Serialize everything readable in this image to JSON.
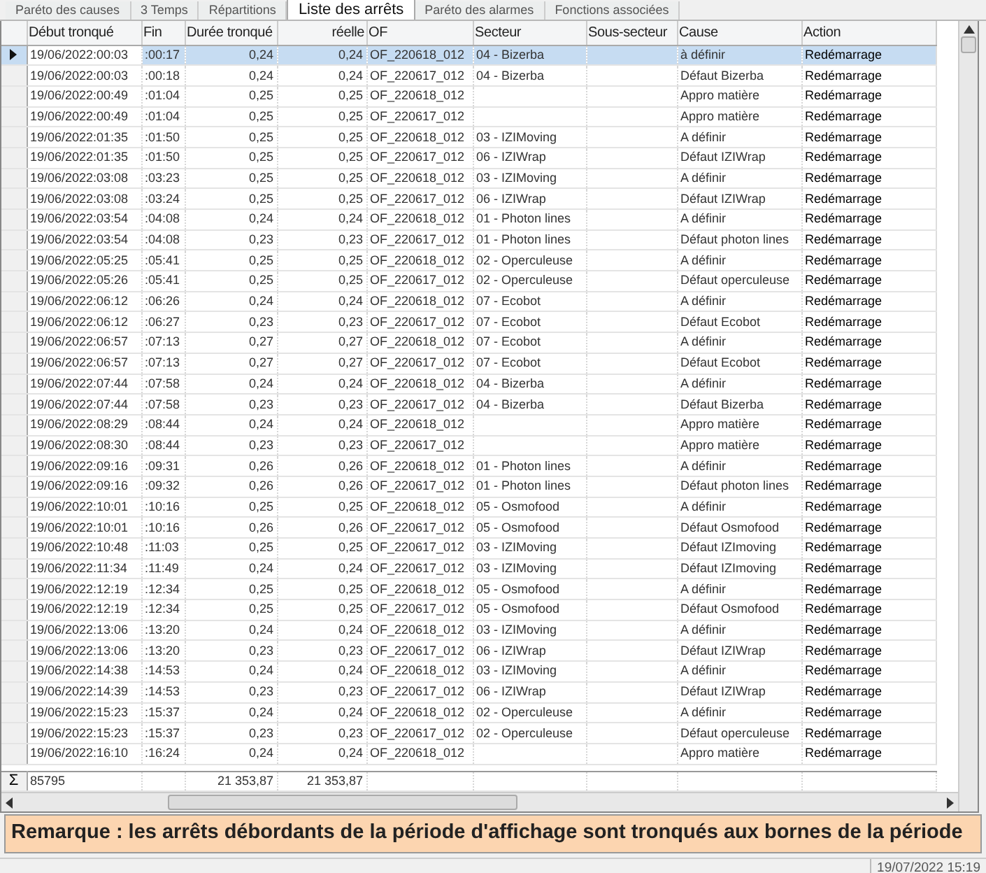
{
  "tabs": [
    {
      "label": "Paréto des causes",
      "selected": false
    },
    {
      "label": "3 Temps",
      "selected": false
    },
    {
      "label": "Répartitions",
      "selected": false
    },
    {
      "label": "Liste des arrêts",
      "selected": true
    },
    {
      "label": "Paréto des alarmes",
      "selected": false
    },
    {
      "label": "Fonctions associées",
      "selected": false
    }
  ],
  "table": {
    "columns": [
      "Début tronqué",
      "Fin",
      "Durée tronqué",
      "réelle",
      "OF",
      "Secteur",
      "Sous-secteur",
      "Cause",
      "Action"
    ],
    "rows": [
      {
        "debut": "19/06/2022:00:03",
        "fin": ":00:17",
        "duree": "0,24",
        "reelle": "0,24",
        "of": "OF_220618_012",
        "secteur": "04 - Bizerba",
        "cause": "à définir",
        "action": "Redémarrage",
        "selected": true
      },
      {
        "debut": "19/06/2022:00:03",
        "fin": ":00:18",
        "duree": "0,24",
        "reelle": "0,24",
        "of": "OF_220617_012",
        "secteur": "04 - Bizerba",
        "cause": "Défaut Bizerba",
        "action": "Redémarrage",
        "selected": false
      },
      {
        "debut": "19/06/2022:00:49",
        "fin": ":01:04",
        "duree": "0,25",
        "reelle": "0,25",
        "of": "OF_220618_012",
        "cause": "Appro matière",
        "action": "Redémarrage",
        "selected": false
      },
      {
        "debut": "19/06/2022:00:49",
        "fin": ":01:04",
        "duree": "0,25",
        "reelle": "0,25",
        "of": "OF_220617_012",
        "cause": "Appro matière",
        "action": "Redémarrage",
        "selected": false
      },
      {
        "debut": "19/06/2022:01:35",
        "fin": ":01:50",
        "duree": "0,25",
        "reelle": "0,25",
        "of": "OF_220618_012",
        "secteur": "03 - IZIMoving",
        "cause": "A définir",
        "action": "Redémarrage",
        "selected": false
      },
      {
        "debut": "19/06/2022:01:35",
        "fin": ":01:50",
        "duree": "0,25",
        "reelle": "0,25",
        "of": "OF_220617_012",
        "secteur": "06 - IZIWrap",
        "cause": "Défaut IZIWrap",
        "action": "Redémarrage",
        "selected": false
      },
      {
        "debut": "19/06/2022:03:08",
        "fin": ":03:23",
        "duree": "0,25",
        "reelle": "0,25",
        "of": "OF_220618_012",
        "secteur": "03 - IZIMoving",
        "cause": "A définir",
        "action": "Redémarrage",
        "selected": false
      },
      {
        "debut": "19/06/2022:03:08",
        "fin": ":03:24",
        "duree": "0,25",
        "reelle": "0,25",
        "of": "OF_220617_012",
        "secteur": "06 - IZIWrap",
        "cause": "Défaut IZIWrap",
        "action": "Redémarrage",
        "selected": false
      },
      {
        "debut": "19/06/2022:03:54",
        "fin": ":04:08",
        "duree": "0,24",
        "reelle": "0,24",
        "of": "OF_220618_012",
        "secteur": "01 - Photon lines",
        "cause": "A définir",
        "action": "Redémarrage",
        "selected": false
      },
      {
        "debut": "19/06/2022:03:54",
        "fin": ":04:08",
        "duree": "0,23",
        "reelle": "0,23",
        "of": "OF_220617_012",
        "secteur": "01 - Photon lines",
        "cause": "Défaut photon lines",
        "action": "Redémarrage",
        "selected": false
      },
      {
        "debut": "19/06/2022:05:25",
        "fin": ":05:41",
        "duree": "0,25",
        "reelle": "0,25",
        "of": "OF_220618_012",
        "secteur": "02 - Operculeuse",
        "cause": "A définir",
        "action": "Redémarrage",
        "selected": false
      },
      {
        "debut": "19/06/2022:05:26",
        "fin": ":05:41",
        "duree": "0,25",
        "reelle": "0,25",
        "of": "OF_220617_012",
        "secteur": "02 - Operculeuse",
        "cause": "Défaut operculeuse",
        "action": "Redémarrage",
        "selected": false
      },
      {
        "debut": "19/06/2022:06:12",
        "fin": ":06:26",
        "duree": "0,24",
        "reelle": "0,24",
        "of": "OF_220618_012",
        "secteur": "07 - Ecobot",
        "cause": "A définir",
        "action": "Redémarrage",
        "selected": false
      },
      {
        "debut": "19/06/2022:06:12",
        "fin": ":06:27",
        "duree": "0,23",
        "reelle": "0,23",
        "of": "OF_220617_012",
        "secteur": "07 - Ecobot",
        "cause": "Défaut Ecobot",
        "action": "Redémarrage",
        "selected": false
      },
      {
        "debut": "19/06/2022:06:57",
        "fin": ":07:13",
        "duree": "0,27",
        "reelle": "0,27",
        "of": "OF_220618_012",
        "secteur": "07 - Ecobot",
        "cause": "A définir",
        "action": "Redémarrage",
        "selected": false
      },
      {
        "debut": "19/06/2022:06:57",
        "fin": ":07:13",
        "duree": "0,27",
        "reelle": "0,27",
        "of": "OF_220617_012",
        "secteur": "07 - Ecobot",
        "cause": "Défaut Ecobot",
        "action": "Redémarrage",
        "selected": false
      },
      {
        "debut": "19/06/2022:07:44",
        "fin": ":07:58",
        "duree": "0,24",
        "reelle": "0,24",
        "of": "OF_220618_012",
        "secteur": "04 - Bizerba",
        "cause": "A définir",
        "action": "Redémarrage",
        "selected": false
      },
      {
        "debut": "19/06/2022:07:44",
        "fin": ":07:58",
        "duree": "0,23",
        "reelle": "0,23",
        "of": "OF_220617_012",
        "secteur": "04 - Bizerba",
        "cause": "Défaut Bizerba",
        "action": "Redémarrage",
        "selected": false
      },
      {
        "debut": "19/06/2022:08:29",
        "fin": ":08:44",
        "duree": "0,24",
        "reelle": "0,24",
        "of": "OF_220618_012",
        "cause": "Appro matière",
        "action": "Redémarrage",
        "selected": false
      },
      {
        "debut": "19/06/2022:08:30",
        "fin": ":08:44",
        "duree": "0,23",
        "reelle": "0,23",
        "of": "OF_220617_012",
        "cause": "Appro matière",
        "action": "Redémarrage",
        "selected": false
      },
      {
        "debut": "19/06/2022:09:16",
        "fin": ":09:31",
        "duree": "0,26",
        "reelle": "0,26",
        "of": "OF_220618_012",
        "secteur": "01 - Photon lines",
        "cause": "A définir",
        "action": "Redémarrage",
        "selected": false
      },
      {
        "debut": "19/06/2022:09:16",
        "fin": ":09:32",
        "duree": "0,26",
        "reelle": "0,26",
        "of": "OF_220617_012",
        "secteur": "01 - Photon lines",
        "cause": "Défaut photon lines",
        "action": "Redémarrage",
        "selected": false
      },
      {
        "debut": "19/06/2022:10:01",
        "fin": ":10:16",
        "duree": "0,25",
        "reelle": "0,25",
        "of": "OF_220618_012",
        "secteur": "05 - Osmofood",
        "cause": "A définir",
        "action": "Redémarrage",
        "selected": false
      },
      {
        "debut": "19/06/2022:10:01",
        "fin": ":10:16",
        "duree": "0,26",
        "reelle": "0,26",
        "of": "OF_220617_012",
        "secteur": "05 - Osmofood",
        "cause": "Défaut Osmofood",
        "action": "Redémarrage",
        "selected": false
      },
      {
        "debut": "19/06/2022:10:48",
        "fin": ":11:03",
        "duree": "0,25",
        "reelle": "0,25",
        "of": "OF_220617_012",
        "secteur": "03 - IZIMoving",
        "cause": "Défaut IZImoving",
        "action": "Redémarrage",
        "selected": false
      },
      {
        "debut": "19/06/2022:11:34",
        "fin": ":11:49",
        "duree": "0,24",
        "reelle": "0,24",
        "of": "OF_220617_012",
        "secteur": "03 - IZIMoving",
        "cause": "Défaut IZImoving",
        "action": "Redémarrage",
        "selected": false
      },
      {
        "debut": "19/06/2022:12:19",
        "fin": ":12:34",
        "duree": "0,25",
        "reelle": "0,25",
        "of": "OF_220618_012",
        "secteur": "05 - Osmofood",
        "cause": "A définir",
        "action": "Redémarrage",
        "selected": false
      },
      {
        "debut": "19/06/2022:12:19",
        "fin": ":12:34",
        "duree": "0,25",
        "reelle": "0,25",
        "of": "OF_220617_012",
        "secteur": "05 - Osmofood",
        "cause": "Défaut Osmofood",
        "action": "Redémarrage",
        "selected": false
      },
      {
        "debut": "19/06/2022:13:06",
        "fin": ":13:20",
        "duree": "0,24",
        "reelle": "0,24",
        "of": "OF_220618_012",
        "secteur": "03 - IZIMoving",
        "cause": "A définir",
        "action": "Redémarrage",
        "selected": false
      },
      {
        "debut": "19/06/2022:13:06",
        "fin": ":13:20",
        "duree": "0,23",
        "reelle": "0,23",
        "of": "OF_220617_012",
        "secteur": "06 - IZIWrap",
        "cause": "Défaut IZIWrap",
        "action": "Redémarrage",
        "selected": false
      },
      {
        "debut": "19/06/2022:14:38",
        "fin": ":14:53",
        "duree": "0,24",
        "reelle": "0,24",
        "of": "OF_220618_012",
        "secteur": "03 - IZIMoving",
        "cause": "A définir",
        "action": "Redémarrage",
        "selected": false
      },
      {
        "debut": "19/06/2022:14:39",
        "fin": ":14:53",
        "duree": "0,23",
        "reelle": "0,23",
        "of": "OF_220617_012",
        "secteur": "06 - IZIWrap",
        "cause": "Défaut IZIWrap",
        "action": "Redémarrage",
        "selected": false
      },
      {
        "debut": "19/06/2022:15:23",
        "fin": ":15:37",
        "duree": "0,24",
        "reelle": "0,24",
        "of": "OF_220618_012",
        "secteur": "02 - Operculeuse",
        "cause": "A définir",
        "action": "Redémarrage",
        "selected": false
      },
      {
        "debut": "19/06/2022:15:23",
        "fin": ":15:37",
        "duree": "0,23",
        "reelle": "0,23",
        "of": "OF_220617_012",
        "secteur": "02 - Operculeuse",
        "cause": "Défaut operculeuse",
        "action": "Redémarrage",
        "selected": false
      },
      {
        "debut": "19/06/2022:16:10",
        "fin": ":16:24",
        "duree": "0,24",
        "reelle": "0,24",
        "of": "OF_220618_012",
        "cause": "Appro matière",
        "action": "Redémarrage",
        "selected": false
      }
    ],
    "totals": {
      "symbol": "Σ",
      "count": "85795",
      "duree": "21 353,87",
      "reelle": "21 353,87"
    }
  },
  "remark": "Remarque : les arrêts débordants de la période d'affichage sont tronqués aux bornes de la période",
  "status_bar": {
    "datetime": "19/07/2022 15:19"
  }
}
